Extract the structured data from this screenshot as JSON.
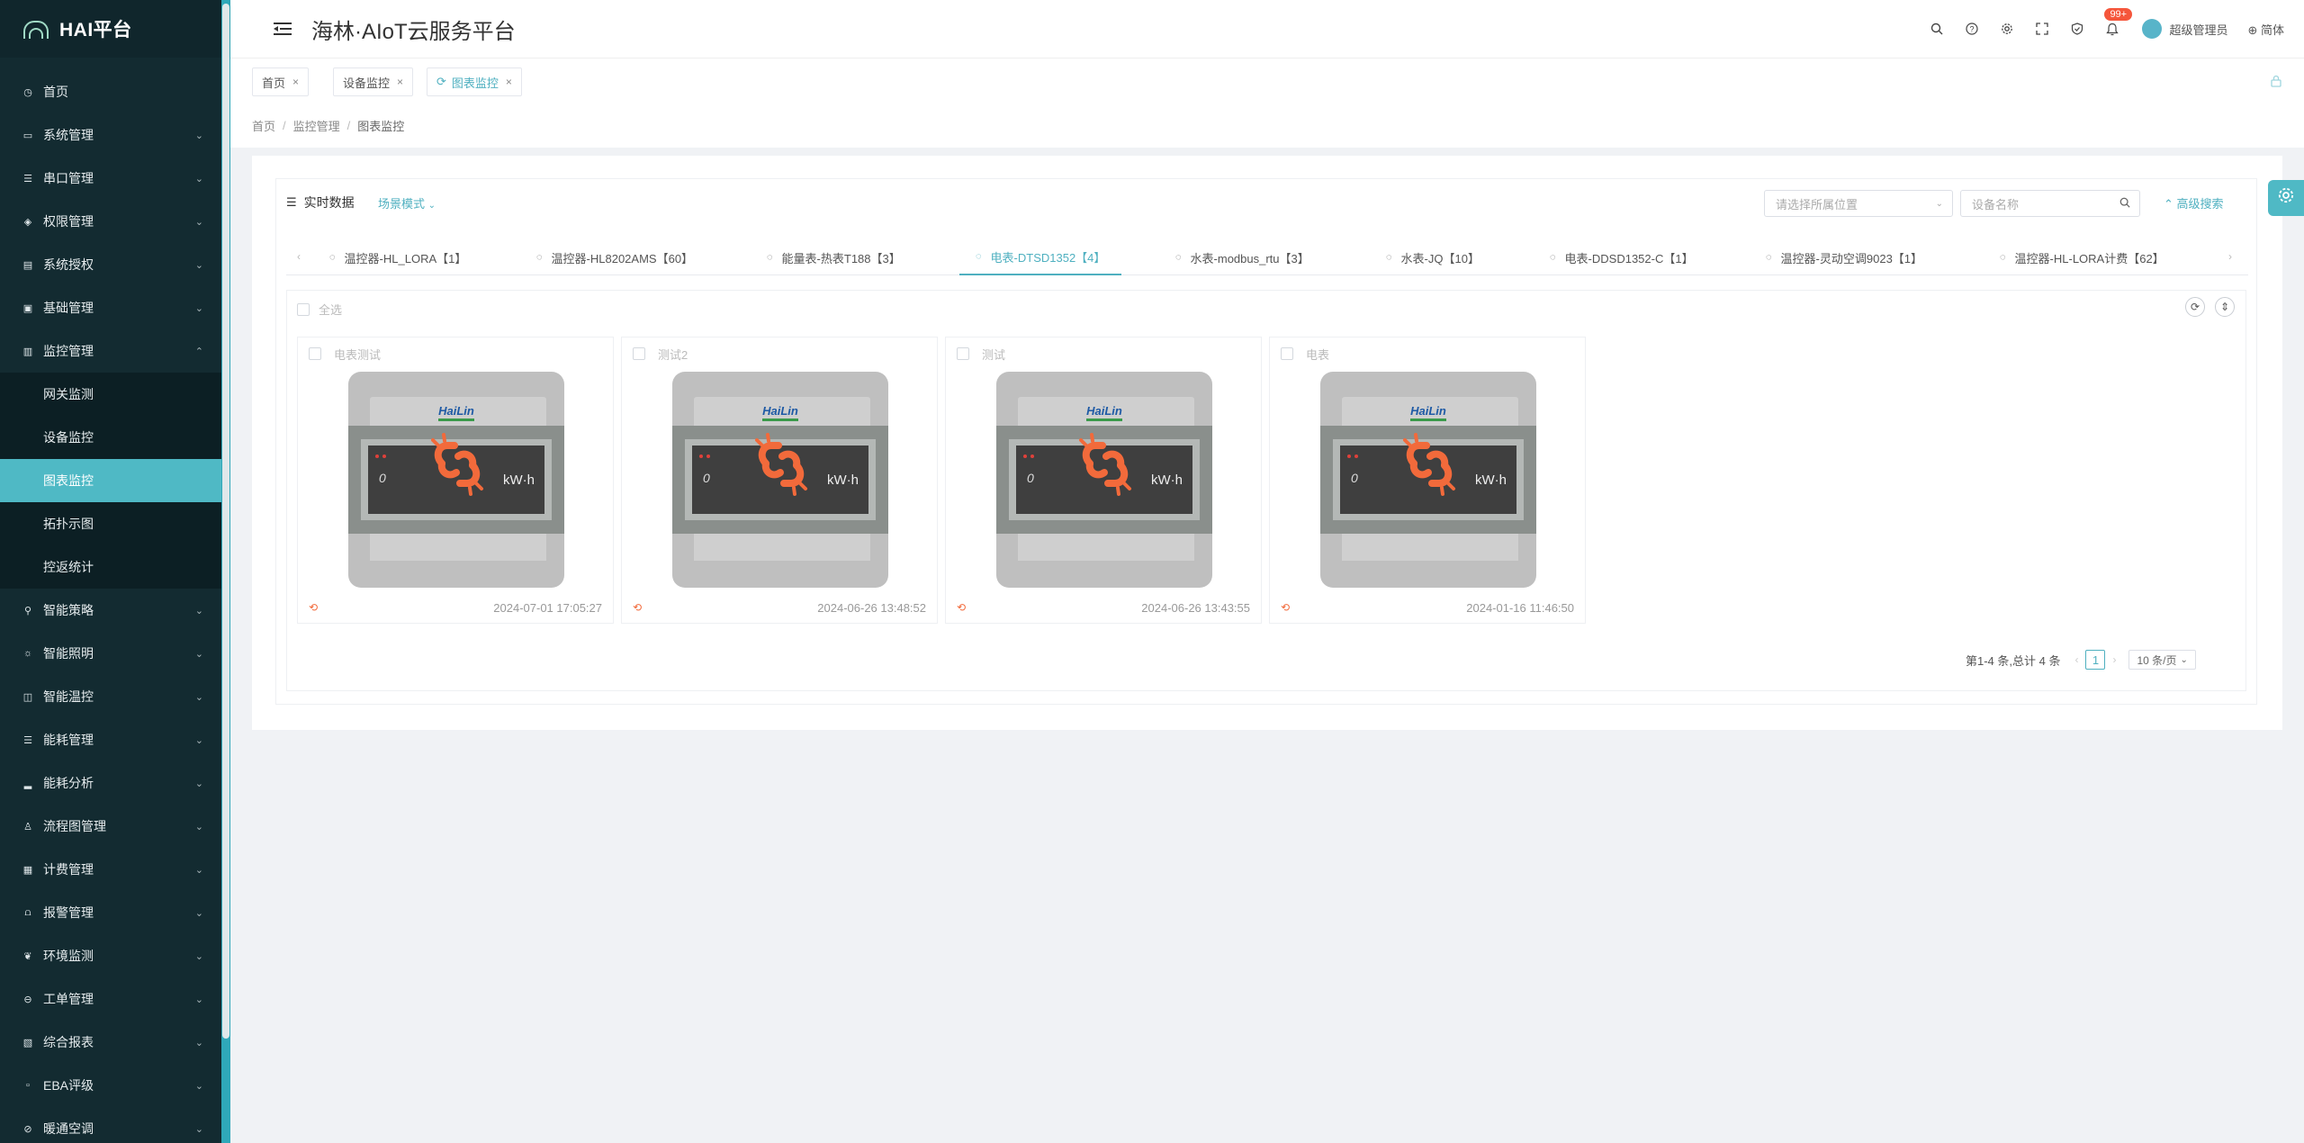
{
  "app": {
    "logo_title": "HAI平台",
    "title": "海林·AIoT云服务平台"
  },
  "header": {
    "badge": "99+",
    "user_name": "超级管理员",
    "language": "简体",
    "icons": [
      "search-icon",
      "help-icon",
      "settings-icon",
      "fullscreen-icon",
      "shield-icon",
      "bell-icon"
    ]
  },
  "sidebar": {
    "items": [
      {
        "label": "首页",
        "icon": "dashboard-icon"
      },
      {
        "label": "系统管理",
        "icon": "monitor-icon"
      },
      {
        "label": "串口管理",
        "icon": "sliders-icon"
      },
      {
        "label": "权限管理",
        "icon": "shield-icon"
      },
      {
        "label": "系统授权",
        "icon": "key-icon"
      },
      {
        "label": "基础管理",
        "icon": "database-icon"
      },
      {
        "label": "监控管理",
        "icon": "monitor-icon"
      }
    ],
    "monitor_sub": [
      {
        "label": "网关监测"
      },
      {
        "label": "设备监控"
      },
      {
        "label": "图表监控"
      },
      {
        "label": "拓扑示图"
      },
      {
        "label": "控返统计"
      }
    ],
    "items_after": [
      {
        "label": "智能策略",
        "icon": "pin-icon"
      },
      {
        "label": "智能照明",
        "icon": "bulb-icon"
      },
      {
        "label": "智能温控",
        "icon": "thermo-icon"
      },
      {
        "label": "能耗管理",
        "icon": "list-icon"
      },
      {
        "label": "能耗分析",
        "icon": "chart-icon"
      },
      {
        "label": "流程图管理",
        "icon": "flow-icon"
      },
      {
        "label": "计费管理",
        "icon": "billing-icon"
      },
      {
        "label": "报警管理",
        "icon": "alarm-icon"
      },
      {
        "label": "环境监测",
        "icon": "leaf-icon"
      },
      {
        "label": "工单管理",
        "icon": "ticket-icon"
      },
      {
        "label": "综合报表",
        "icon": "report-icon"
      },
      {
        "label": "EBA评级",
        "icon": "grade-icon"
      },
      {
        "label": "暖通空调",
        "icon": "hvac-icon"
      }
    ]
  },
  "tabs": [
    {
      "label": "首页"
    },
    {
      "label": "设备监控"
    },
    {
      "label": "图表监控"
    }
  ],
  "breadcrumb": [
    "首页",
    "监控管理",
    "图表监控"
  ],
  "toolbar": {
    "title": "实时数据",
    "scene_mode": "场景模式",
    "location_placeholder": "请选择所属位置",
    "device_placeholder": "设备名称",
    "advanced_search": "高级搜索"
  },
  "device_tabs": [
    {
      "label": "温控器-HL_LORA【1】"
    },
    {
      "label": "温控器-HL8202AMS【60】"
    },
    {
      "label": "能量表-热表T188【3】"
    },
    {
      "label": "电表-DTSD1352【4】"
    },
    {
      "label": "水表-modbus_rtu【3】"
    },
    {
      "label": "水表-JQ【10】"
    },
    {
      "label": "电表-DDSD1352-C【1】"
    },
    {
      "label": "温控器-灵动空调9023【1】"
    },
    {
      "label": "温控器-HL-LORA计费【62】"
    }
  ],
  "grid": {
    "select_all": "全选",
    "devices": [
      {
        "name": "电表测试",
        "brand": "HaiLin",
        "digit": "0",
        "unit": "kW·h",
        "time": "2024-07-01 17:05:27"
      },
      {
        "name": "测试2",
        "brand": "HaiLin",
        "digit": "0",
        "unit": "kW·h",
        "time": "2024-06-26 13:48:52"
      },
      {
        "name": "测试",
        "brand": "HaiLin",
        "digit": "0",
        "unit": "kW·h",
        "time": "2024-06-26 13:43:55"
      },
      {
        "name": "电表",
        "brand": "HaiLin",
        "digit": "0",
        "unit": "kW·h",
        "time": "2024-01-16 11:46:50"
      }
    ]
  },
  "pagination": {
    "summary": "第1-4 条,总计 4 条",
    "current_page": "1",
    "page_size": "10 条/页"
  },
  "colors": {
    "accent": "#4fb9c5",
    "sidebar_bg": "#132b31",
    "badge": "#f5563b",
    "broken_link": "#f26a3b"
  }
}
